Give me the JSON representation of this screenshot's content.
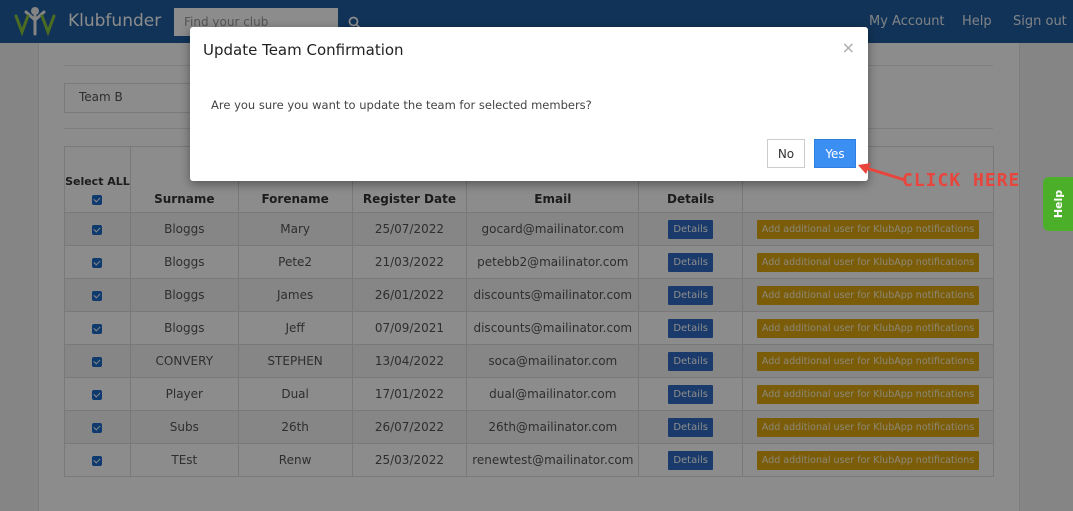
{
  "header": {
    "brand": "Klubfunder",
    "search_placeholder": "Find your club",
    "nav": [
      "My Account",
      "Help",
      "Sign out"
    ]
  },
  "team": {
    "selected": "Team B"
  },
  "table": {
    "select_all_label": "Select ALL",
    "columns": [
      "Surname",
      "Forename",
      "Register Date",
      "Email",
      "Details"
    ],
    "details_label": "Details",
    "add_user_label": "Add additional user for KlubApp notifications",
    "rows": [
      {
        "surname": "Bloggs",
        "forename": "Mary",
        "date": "25/07/2022",
        "email": "gocard@mailinator.com"
      },
      {
        "surname": "Bloggs",
        "forename": "Pete2",
        "date": "21/03/2022",
        "email": "petebb2@mailinator.com"
      },
      {
        "surname": "Bloggs",
        "forename": "James",
        "date": "26/01/2022",
        "email": "discounts@mailinator.com"
      },
      {
        "surname": "Bloggs",
        "forename": "Jeff",
        "date": "07/09/2021",
        "email": "discounts@mailinator.com"
      },
      {
        "surname": "CONVERY",
        "forename": "STEPHEN",
        "date": "13/04/2022",
        "email": "soca@mailinator.com"
      },
      {
        "surname": "Player",
        "forename": "Dual",
        "date": "17/01/2022",
        "email": "dual@mailinator.com"
      },
      {
        "surname": "Subs",
        "forename": "26th",
        "date": "26/07/2022",
        "email": "26th@mailinator.com"
      },
      {
        "surname": "TEst",
        "forename": "Renw",
        "date": "25/03/2022",
        "email": "renewtest@mailinator.com"
      }
    ]
  },
  "modal": {
    "title": "Update Team Confirmation",
    "close": "×",
    "message": "Are you sure you want to update the team for selected members?",
    "no_label": "No",
    "yes_label": "Yes"
  },
  "annotation": {
    "text": "CLICK HERE",
    "color": "#e8453c"
  },
  "help_tab": {
    "label": "Help"
  },
  "colors": {
    "navbar": "#1f5d9e",
    "primary": "#3b8ff2",
    "warning": "#e0a911",
    "help": "#4caf2a"
  }
}
